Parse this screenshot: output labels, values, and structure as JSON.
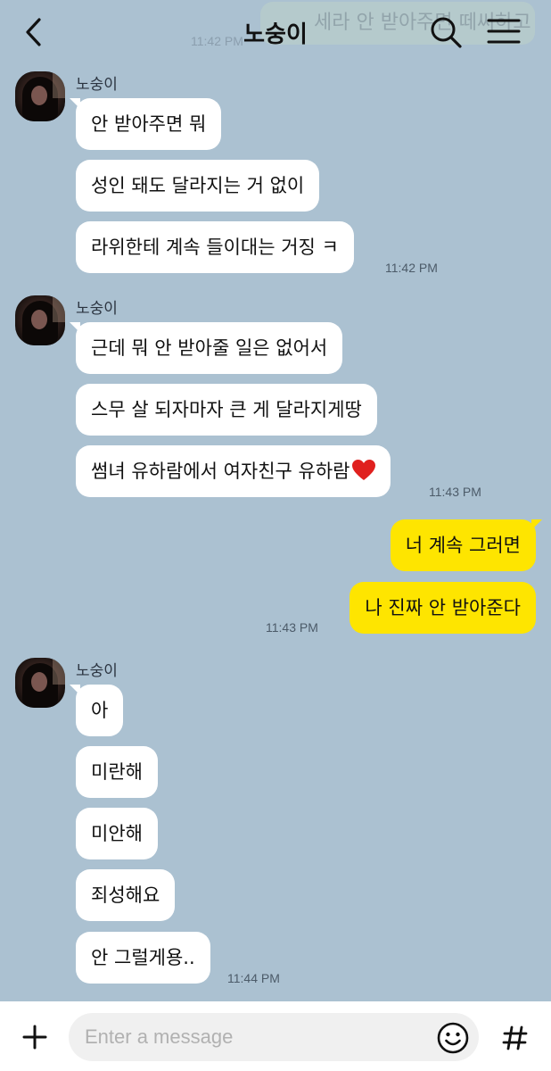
{
  "header": {
    "title": "노숭이",
    "ghost_text": "세라 안 받아주면 떼써하고",
    "ghost_time": "11:42 PM",
    "back_icon": "back-chevron-icon",
    "search_icon": "search-icon",
    "menu_icon": "hamburger-menu-icon"
  },
  "groups": [
    {
      "sender": "노숭이",
      "messages": [
        "안 받아주면 뭐",
        "성인 돼도 달라지는 거 없이",
        "라위한테 계속 들이대는 거징 ㅋ"
      ],
      "time": "11:42 PM"
    },
    {
      "sender": "노숭이",
      "messages": [
        "근데 뭐 안 받아줄 일은 없어서",
        "스무 살 되자마자 큰 게 달라지게땅",
        "썸녀 유하람에서 여자친구 유하람"
      ],
      "time": "11:43 PM"
    },
    {
      "sender": "me",
      "messages": [
        "너 계속 그러면",
        "나 진짜 안 받아준다"
      ],
      "time": "11:43 PM"
    },
    {
      "sender": "노숭이",
      "messages": [
        "아",
        "미란해",
        "미안해",
        "죄성해요",
        "안 그럴게용.."
      ],
      "time": "11:44 PM"
    }
  ],
  "input": {
    "placeholder": "Enter a message",
    "plus_icon": "plus-icon",
    "emoji_icon": "emoji-smile-icon",
    "hash_icon": "hashtag-icon"
  },
  "colors": {
    "background": "#abc1d1",
    "my_bubble": "#fee500",
    "their_bubble": "#ffffff",
    "heart": "#e0201e"
  }
}
